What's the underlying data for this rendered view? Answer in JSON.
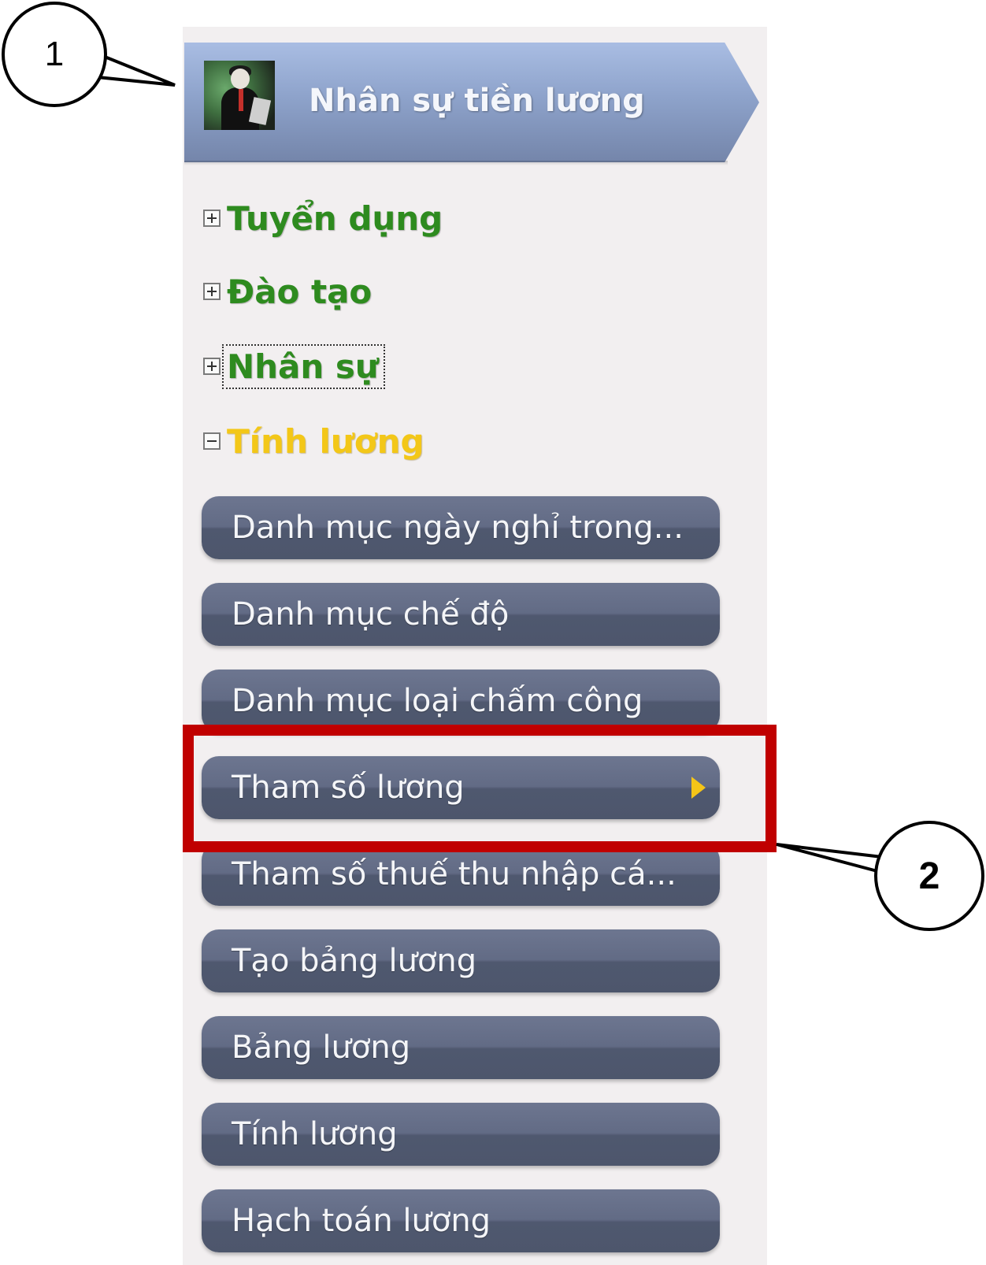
{
  "module": {
    "title": "Nhân sự tiền lương",
    "avatar_icon": "employee-avatar-icon"
  },
  "groups": [
    {
      "label": "Tuyển dụng",
      "state": "collapsed"
    },
    {
      "label": "Đào tạo",
      "state": "collapsed"
    },
    {
      "label": "Nhân sự",
      "state": "collapsed",
      "focused": true
    },
    {
      "label": "Tính lương",
      "state": "expanded"
    }
  ],
  "items": [
    {
      "label": "Danh mục ngày nghỉ trong..."
    },
    {
      "label": "Danh mục chế độ"
    },
    {
      "label": "Danh mục loại chấm công"
    },
    {
      "label": "Tham số lương",
      "selected": true
    },
    {
      "label": "Tham số thuế thu nhập cá..."
    },
    {
      "label": "Tạo bảng lương"
    },
    {
      "label": "Bảng lương"
    },
    {
      "label": "Tính lương"
    },
    {
      "label": "Hạch toán lương"
    }
  ],
  "callouts": [
    {
      "label": "1"
    },
    {
      "label": "2"
    }
  ],
  "colors": {
    "group_text": "#2e8b1f",
    "active_group_text": "#f3c718",
    "item_bg": "#5c6580",
    "highlight": "#c00000",
    "selected_arrow": "#f5c518"
  }
}
